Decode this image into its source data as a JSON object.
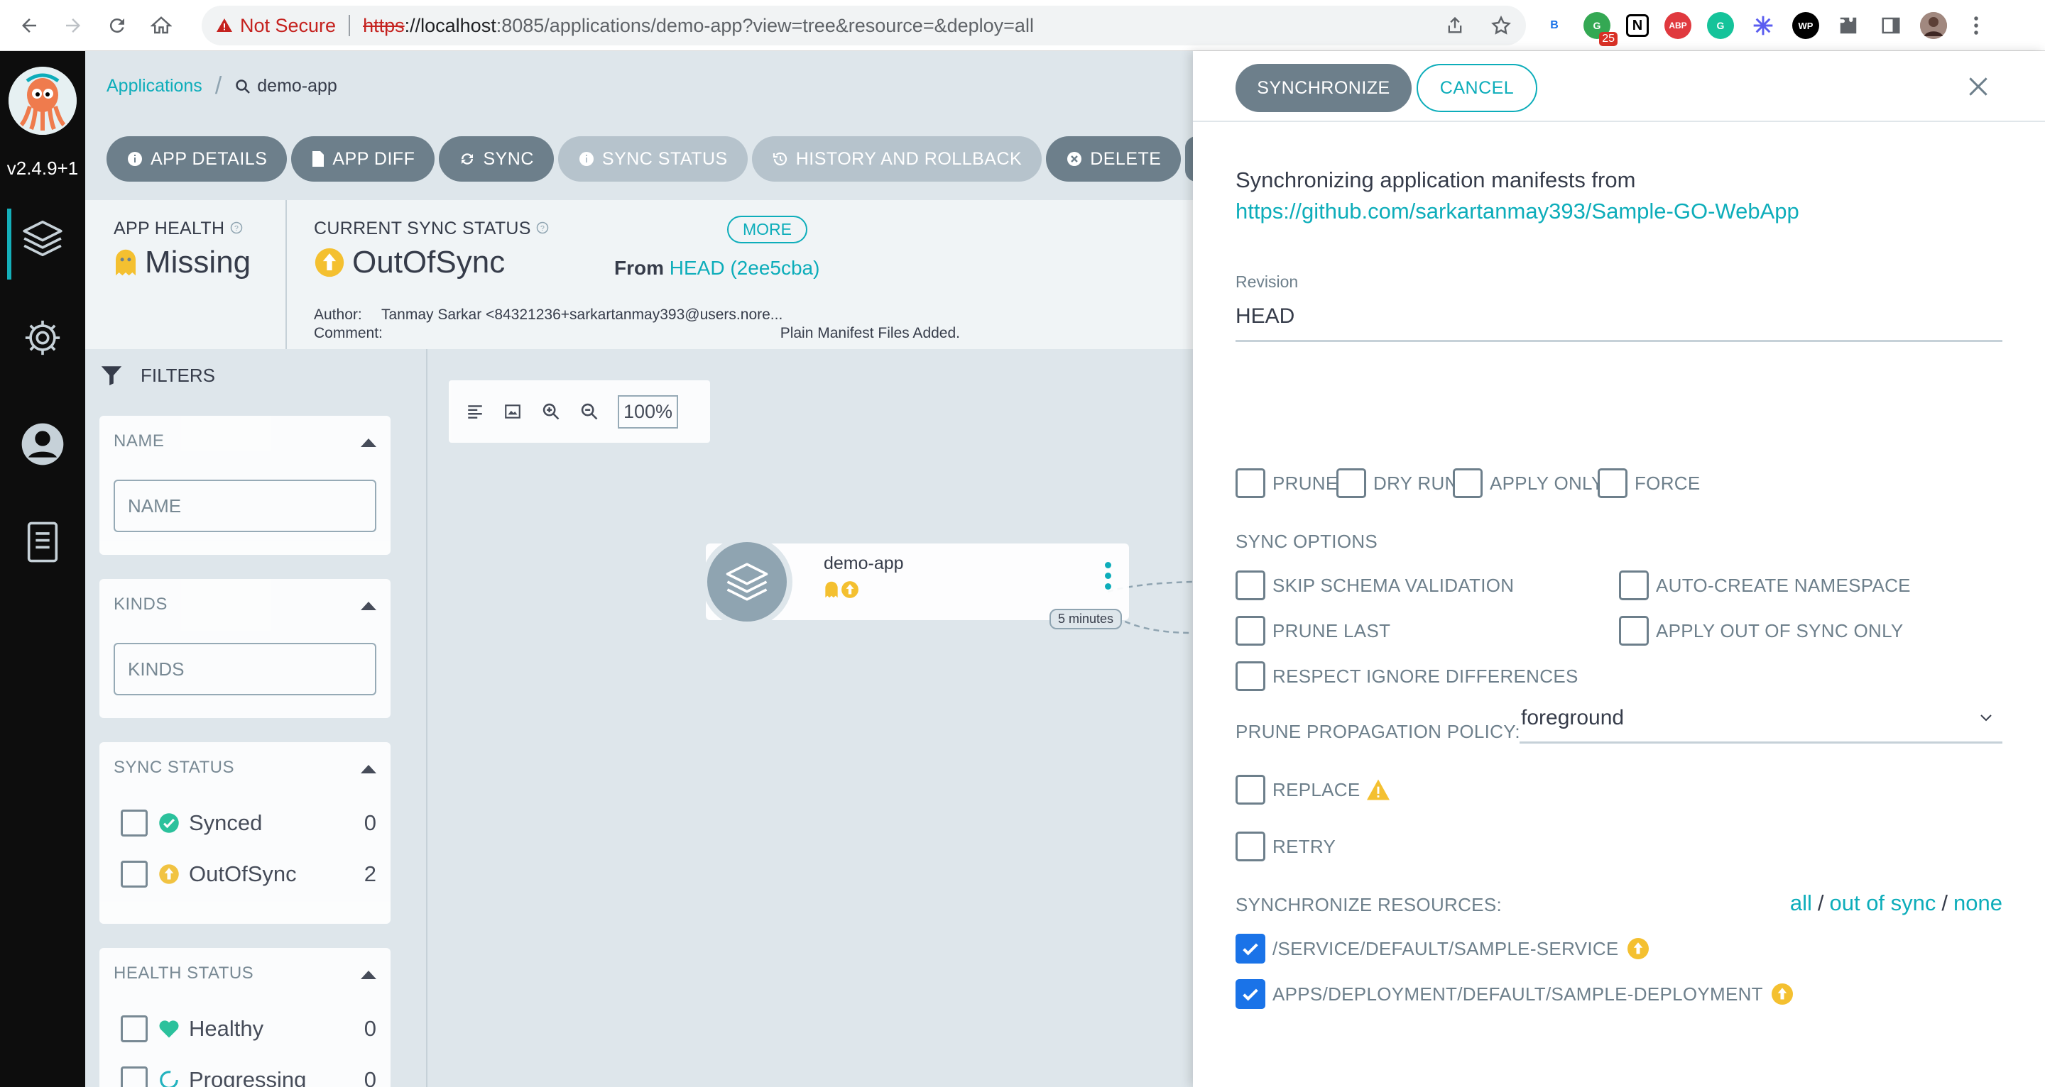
{
  "browser": {
    "warning": "Not Secure",
    "url_scheme": "https",
    "url_host": "://localhost",
    "url_rest": ":8085/applications/demo-app?view=tree&resource=&deploy=all",
    "ext_b_label": "B",
    "ext_badge": "25",
    "ext_n_label": "N",
    "ext_abp_label": "ABP",
    "ext_wp_label": "WP"
  },
  "nav": {
    "version": "v2.4.9+1"
  },
  "breadcrumb": {
    "root": "Applications",
    "current": "demo-app"
  },
  "toolbar": {
    "app_details": "APP DETAILS",
    "app_diff": "APP DIFF",
    "sync": "SYNC",
    "sync_status": "SYNC STATUS",
    "history": "HISTORY AND ROLLBACK",
    "delete": "DELETE"
  },
  "status": {
    "app_health_title": "APP HEALTH",
    "app_health_value": "Missing",
    "sync_title": "CURRENT SYNC STATUS",
    "sync_value": "OutOfSync",
    "more": "MORE",
    "from_label": "From",
    "from_rev": "HEAD (2ee5cba)",
    "author_label": "Author:",
    "author_value": "Tanmay Sarkar <84321236+sarkartanmay393@users.nore...",
    "comment_label": "Comment:",
    "comment_value": "Plain Manifest Files Added."
  },
  "filters": {
    "title": "FILTERS",
    "name_title": "NAME",
    "name_placeholder": "NAME",
    "kinds_title": "KINDS",
    "kinds_placeholder": "KINDS",
    "sync_title": "SYNC STATUS",
    "synced_label": "Synced",
    "synced_count": "0",
    "outofsync_label": "OutOfSync",
    "outofsync_count": "2",
    "health_title": "HEALTH STATUS",
    "healthy_label": "Healthy",
    "healthy_count": "0",
    "progressing_label": "Progressing",
    "progressing_count": "0"
  },
  "graph": {
    "zoom": "100%",
    "node_name": "demo-app",
    "node_age": "5 minutes"
  },
  "panel": {
    "synchronize": "SYNCHRONIZE",
    "cancel": "CANCEL",
    "intro": "Synchronizing application manifests from",
    "repo_url": "https://github.com/sarkartanmay393/Sample-GO-WebApp",
    "revision_label": "Revision",
    "revision_value": "HEAD",
    "opt_prune": "PRUNE",
    "opt_dry_run": "DRY RUN",
    "opt_apply_only": "APPLY ONLY",
    "opt_force": "FORCE",
    "sync_options_title": "SYNC OPTIONS",
    "skip_schema": "SKIP SCHEMA VALIDATION",
    "auto_ns": "AUTO-CREATE NAMESPACE",
    "prune_last": "PRUNE LAST",
    "apply_oos": "APPLY OUT OF SYNC ONLY",
    "respect_ignore": "RESPECT IGNORE DIFFERENCES",
    "policy_label": "PRUNE PROPAGATION POLICY:",
    "policy_value": "foreground",
    "replace": "REPLACE",
    "retry": "RETRY",
    "resources_title": "SYNCHRONIZE RESOURCES:",
    "res_all": "all",
    "res_out_of_sync": "out of sync",
    "res_none": "none",
    "res_sep": "/",
    "resource_1": "/SERVICE/DEFAULT/SAMPLE-SERVICE",
    "resource_2": "APPS/DEPLOYMENT/DEFAULT/SAMPLE-DEPLOYMENT"
  },
  "colors": {
    "accent": "#0dadba",
    "warning": "#f4c030",
    "checkbox_checked": "#1a73e8",
    "nav_bg": "#0d0d0d"
  }
}
